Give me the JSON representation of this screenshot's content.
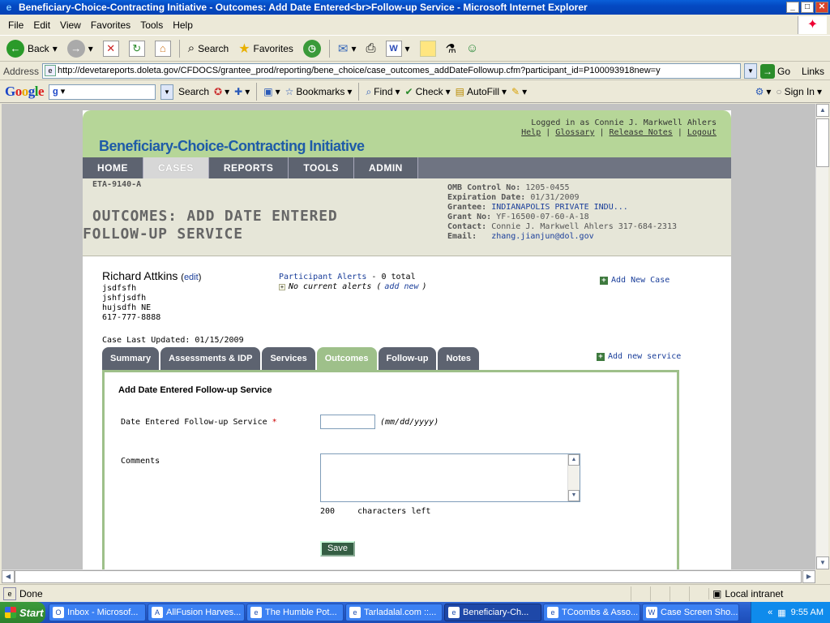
{
  "window": {
    "title": "Beneficiary-Choice-Contracting Initiative - Outcomes: Add Date Entered<br>Follow-up Service - Microsoft Internet Explorer",
    "min": "_",
    "max": "□",
    "close": "✕"
  },
  "menu": [
    "File",
    "Edit",
    "View",
    "Favorites",
    "Tools",
    "Help"
  ],
  "toolbar": {
    "back": "Back",
    "search": "Search",
    "favorites": "Favorites"
  },
  "address": {
    "label": "Address",
    "url": "http://devetareports.doleta.gov/CFDOCS/grantee_prod/reporting/bene_choice/case_outcomes_addDateFollowup.cfm?participant_id=P100093918new=y",
    "go": "Go",
    "links": "Links"
  },
  "google": {
    "search": "Search",
    "bookmarks": "Bookmarks",
    "find": "Find",
    "check": "Check",
    "autofill": "AutoFill",
    "signin": "Sign In"
  },
  "site": {
    "title": "Beneficiary-Choice-Contracting Initiative",
    "logged_in": "Logged in as Connie J. Markwell Ahlers",
    "links": [
      "Help",
      "Glossary",
      "Release Notes",
      "Logout"
    ],
    "nav": [
      "HOME",
      "CASES",
      "REPORTS",
      "TOOLS",
      "ADMIN"
    ]
  },
  "info": {
    "eta": "ETA-9140-A",
    "heading_line1": "OUTCOMES: ADD DATE ENTERED",
    "heading_line2": "FOLLOW-UP SERVICE",
    "omb_label": "OMB Control No:",
    "omb": "1205-0455",
    "exp_label": "Expiration Date:",
    "exp": "01/31/2009",
    "grantee_label": "Grantee:",
    "grantee": "INDIANAPOLIS PRIVATE INDU...",
    "grant_label": "Grant No:",
    "grant": "YF-16500-07-60-A-18",
    "contact_label": "Contact:",
    "contact": "Connie J. Markwell Ahlers  317-684-2313",
    "email_label": "Email:",
    "email": "zhang.jianjun@dol.gov"
  },
  "participant": {
    "name": "Richard Attkins",
    "edit": "edit",
    "line1": "jsdfsfh",
    "line2": "jshfjsdfh",
    "line3": "hujsdfh NE",
    "phone": "617-777-8888",
    "alerts_link": "Participant Alerts",
    "alerts_count": "- 0 total",
    "no_alerts": "No current alerts (",
    "add_new": "add new",
    "close_paren": ")",
    "add_case": "Add New Case",
    "updated": "Case Last Updated: 01/15/2009",
    "add_service": "Add new service"
  },
  "tabs": [
    "Summary",
    "Assessments & IDP",
    "Services",
    "Outcomes",
    "Follow-up",
    "Notes"
  ],
  "form": {
    "title": "Add Date Entered Follow-up Service",
    "date_label": "Date Entered Follow-up Service",
    "required": "*",
    "date_value": "",
    "date_hint": "(mm/dd/yyyy)",
    "comments_label": "Comments",
    "chars_count": "200",
    "chars_left": "characters left",
    "save": "Save"
  },
  "status": {
    "done": "Done",
    "zone": "Local intranet"
  },
  "taskbar": {
    "start": "Start",
    "tasks": [
      "Inbox - Microsof...",
      "AllFusion Harves...",
      "The Humble Pot...",
      "Tarladalal.com ::...",
      "Beneficiary-Ch...",
      "TCoombs & Asso...",
      "Case Screen Sho..."
    ],
    "time": "9:55 AM"
  }
}
